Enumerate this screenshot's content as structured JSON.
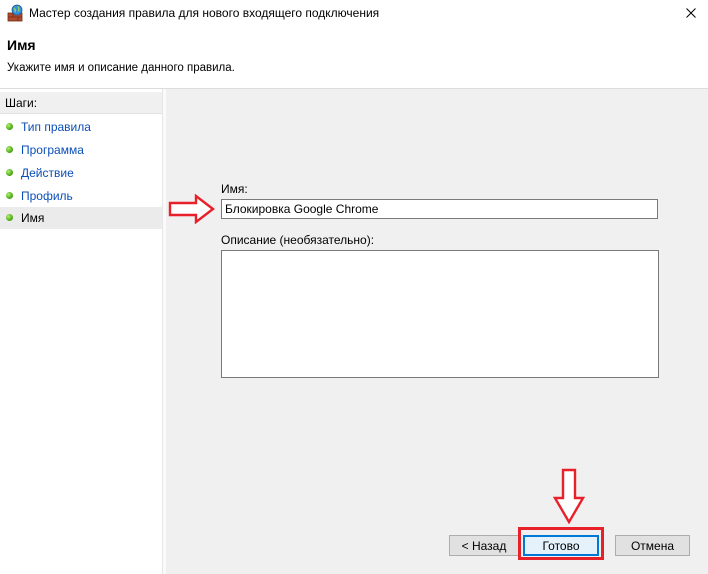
{
  "window": {
    "title": "Мастер создания правила для нового входящего подключения",
    "icon": "firewall-icon",
    "close_icon": "close-icon"
  },
  "header": {
    "heading": "Имя",
    "subtitle": "Укажите имя и описание данного правила."
  },
  "steps": {
    "header": "Шаги:",
    "items": [
      {
        "label": "Тип правила",
        "state": "done"
      },
      {
        "label": "Программа",
        "state": "done"
      },
      {
        "label": "Действие",
        "state": "done"
      },
      {
        "label": "Профиль",
        "state": "done"
      },
      {
        "label": "Имя",
        "state": "current"
      }
    ]
  },
  "form": {
    "name_label": "Имя:",
    "name_value": "Блокировка Google Chrome",
    "description_label": "Описание (необязательно):",
    "description_value": ""
  },
  "buttons": {
    "back": "< Назад",
    "finish": "Готово",
    "cancel": "Отмена"
  },
  "annotations": {
    "color": "#e8202a",
    "right_arrow_icon": "arrow-right-icon",
    "down_arrow_icon": "arrow-down-icon"
  }
}
